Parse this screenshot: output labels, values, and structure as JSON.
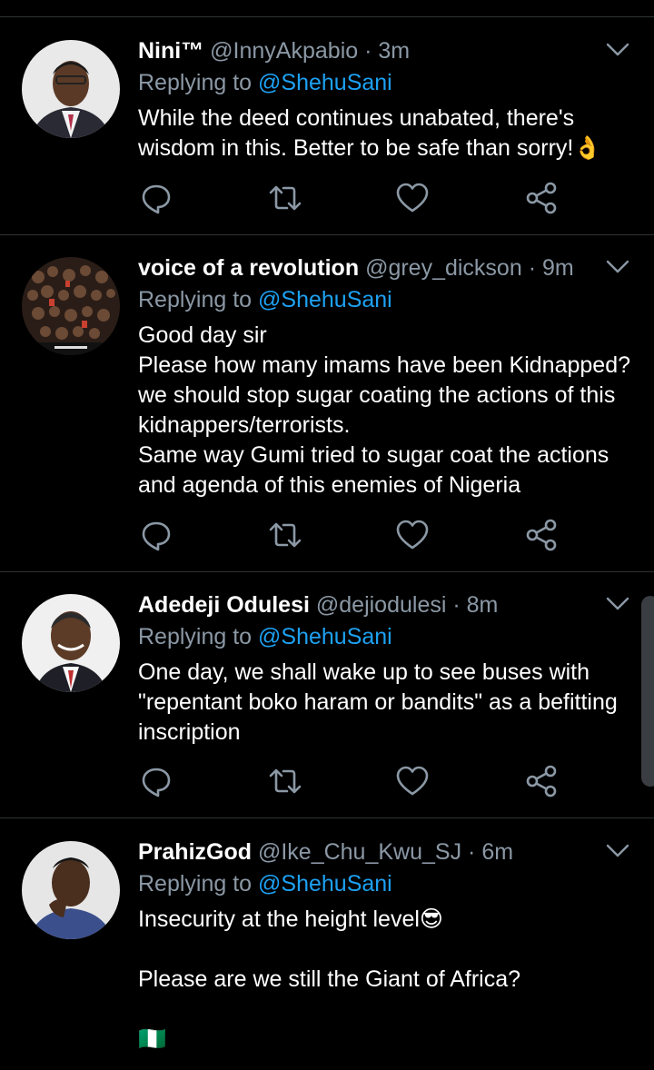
{
  "colors": {
    "accent": "#1da1f2",
    "muted": "#8b98a5",
    "background": "#000000",
    "divider": "#2f3336"
  },
  "tweets": [
    {
      "name": "Nini™",
      "handle": "@InnyAkpabio",
      "separator": "·",
      "time": "3m",
      "replying_prefix": "Replying to ",
      "replying_to": "@ShehuSani",
      "text": "While the deed continues unabated, there's wisdom in this. Better to be safe than sorry!👌",
      "avatar": "user-avatar-photo"
    },
    {
      "name": "voice of a revolution",
      "handle": "@grey_dickson",
      "separator": "·",
      "time": "9m",
      "replying_prefix": "Replying to ",
      "replying_to": "@ShehuSani",
      "text": "Good day sir\nPlease how many imams have been Kidnapped? we should stop sugar coating the actions of this kidnappers/terrorists.\nSame way Gumi tried to sugar coat the actions and agenda of this enemies of Nigeria",
      "avatar": "crowd-collage-avatar"
    },
    {
      "name": "Adedeji Odulesi",
      "handle": "@dejiodulesi",
      "separator": "·",
      "time": "8m",
      "replying_prefix": "Replying to ",
      "replying_to": "@ShehuSani",
      "text": "One day, we shall wake up to see buses with \"repentant boko haram or bandits\" as a befitting inscription",
      "avatar": "user-avatar-photo"
    },
    {
      "name": "PrahizGod",
      "handle": "@Ike_Chu_Kwu_SJ",
      "separator": "·",
      "time": "6m",
      "replying_prefix": "Replying to ",
      "replying_to": "@ShehuSani",
      "text": "Insecurity at the height level😎\n\nPlease are we still the Giant of Africa?\n\n🇳🇬",
      "avatar": "user-avatar-photo"
    }
  ],
  "icons": {
    "reply": "reply-icon",
    "retweet": "retweet-icon",
    "like": "heart-icon",
    "share": "share-icon",
    "menu": "chevron-down-icon"
  }
}
